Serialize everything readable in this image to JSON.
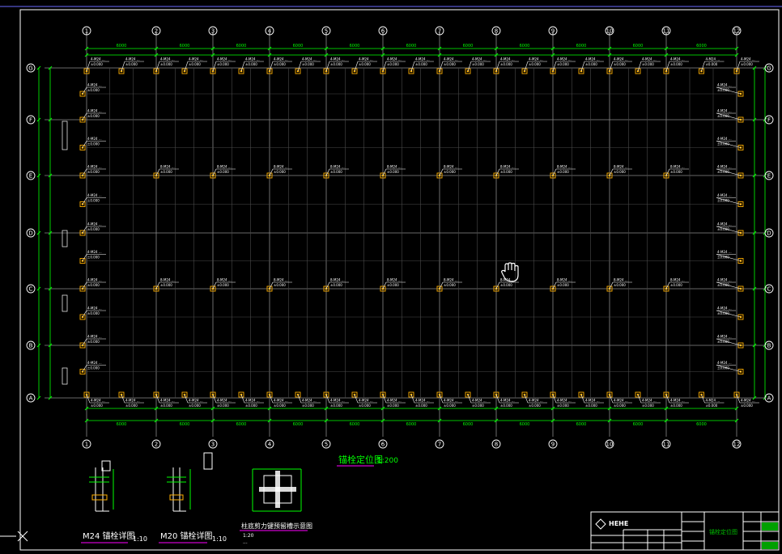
{
  "drawing": {
    "title": "锚栓定位图",
    "scale": "1:200",
    "axis_numbers": [
      "1",
      "2",
      "3",
      "4",
      "5",
      "6",
      "7",
      "8",
      "9",
      "10",
      "11",
      "12"
    ],
    "axis_letters": [
      "A",
      "B",
      "C",
      "D",
      "E",
      "F",
      "G"
    ],
    "tag_top": "4-M24 ...",
    "tag_bottom": "4-M24 ...",
    "tag_side": "4-M24 ...",
    "tag_interior": "8-M24 ...",
    "elev": "±0.000",
    "dim_segment": "6000"
  },
  "details": {
    "m24_label": "M24 锚栓详图",
    "m24_scale": "1:10",
    "m20_label": "M20 锚栓详图",
    "m20_scale": "1:10",
    "base_label": "柱底剪力键预留槽示意图",
    "base_sub1": "1:20",
    "base_sub2": "..."
  },
  "title_block": {
    "company": "HEHE",
    "sheet_title": "锚栓定位图"
  },
  "colors": {
    "background": "#000000",
    "frame": "#ffffff",
    "grid": "#8a8a8a",
    "dimension": "#00ff00",
    "bolt": "#ffb000",
    "magenta": "#ff00ff",
    "highlight": "#00c000"
  },
  "cursor_icon": "hand-cursor-icon"
}
